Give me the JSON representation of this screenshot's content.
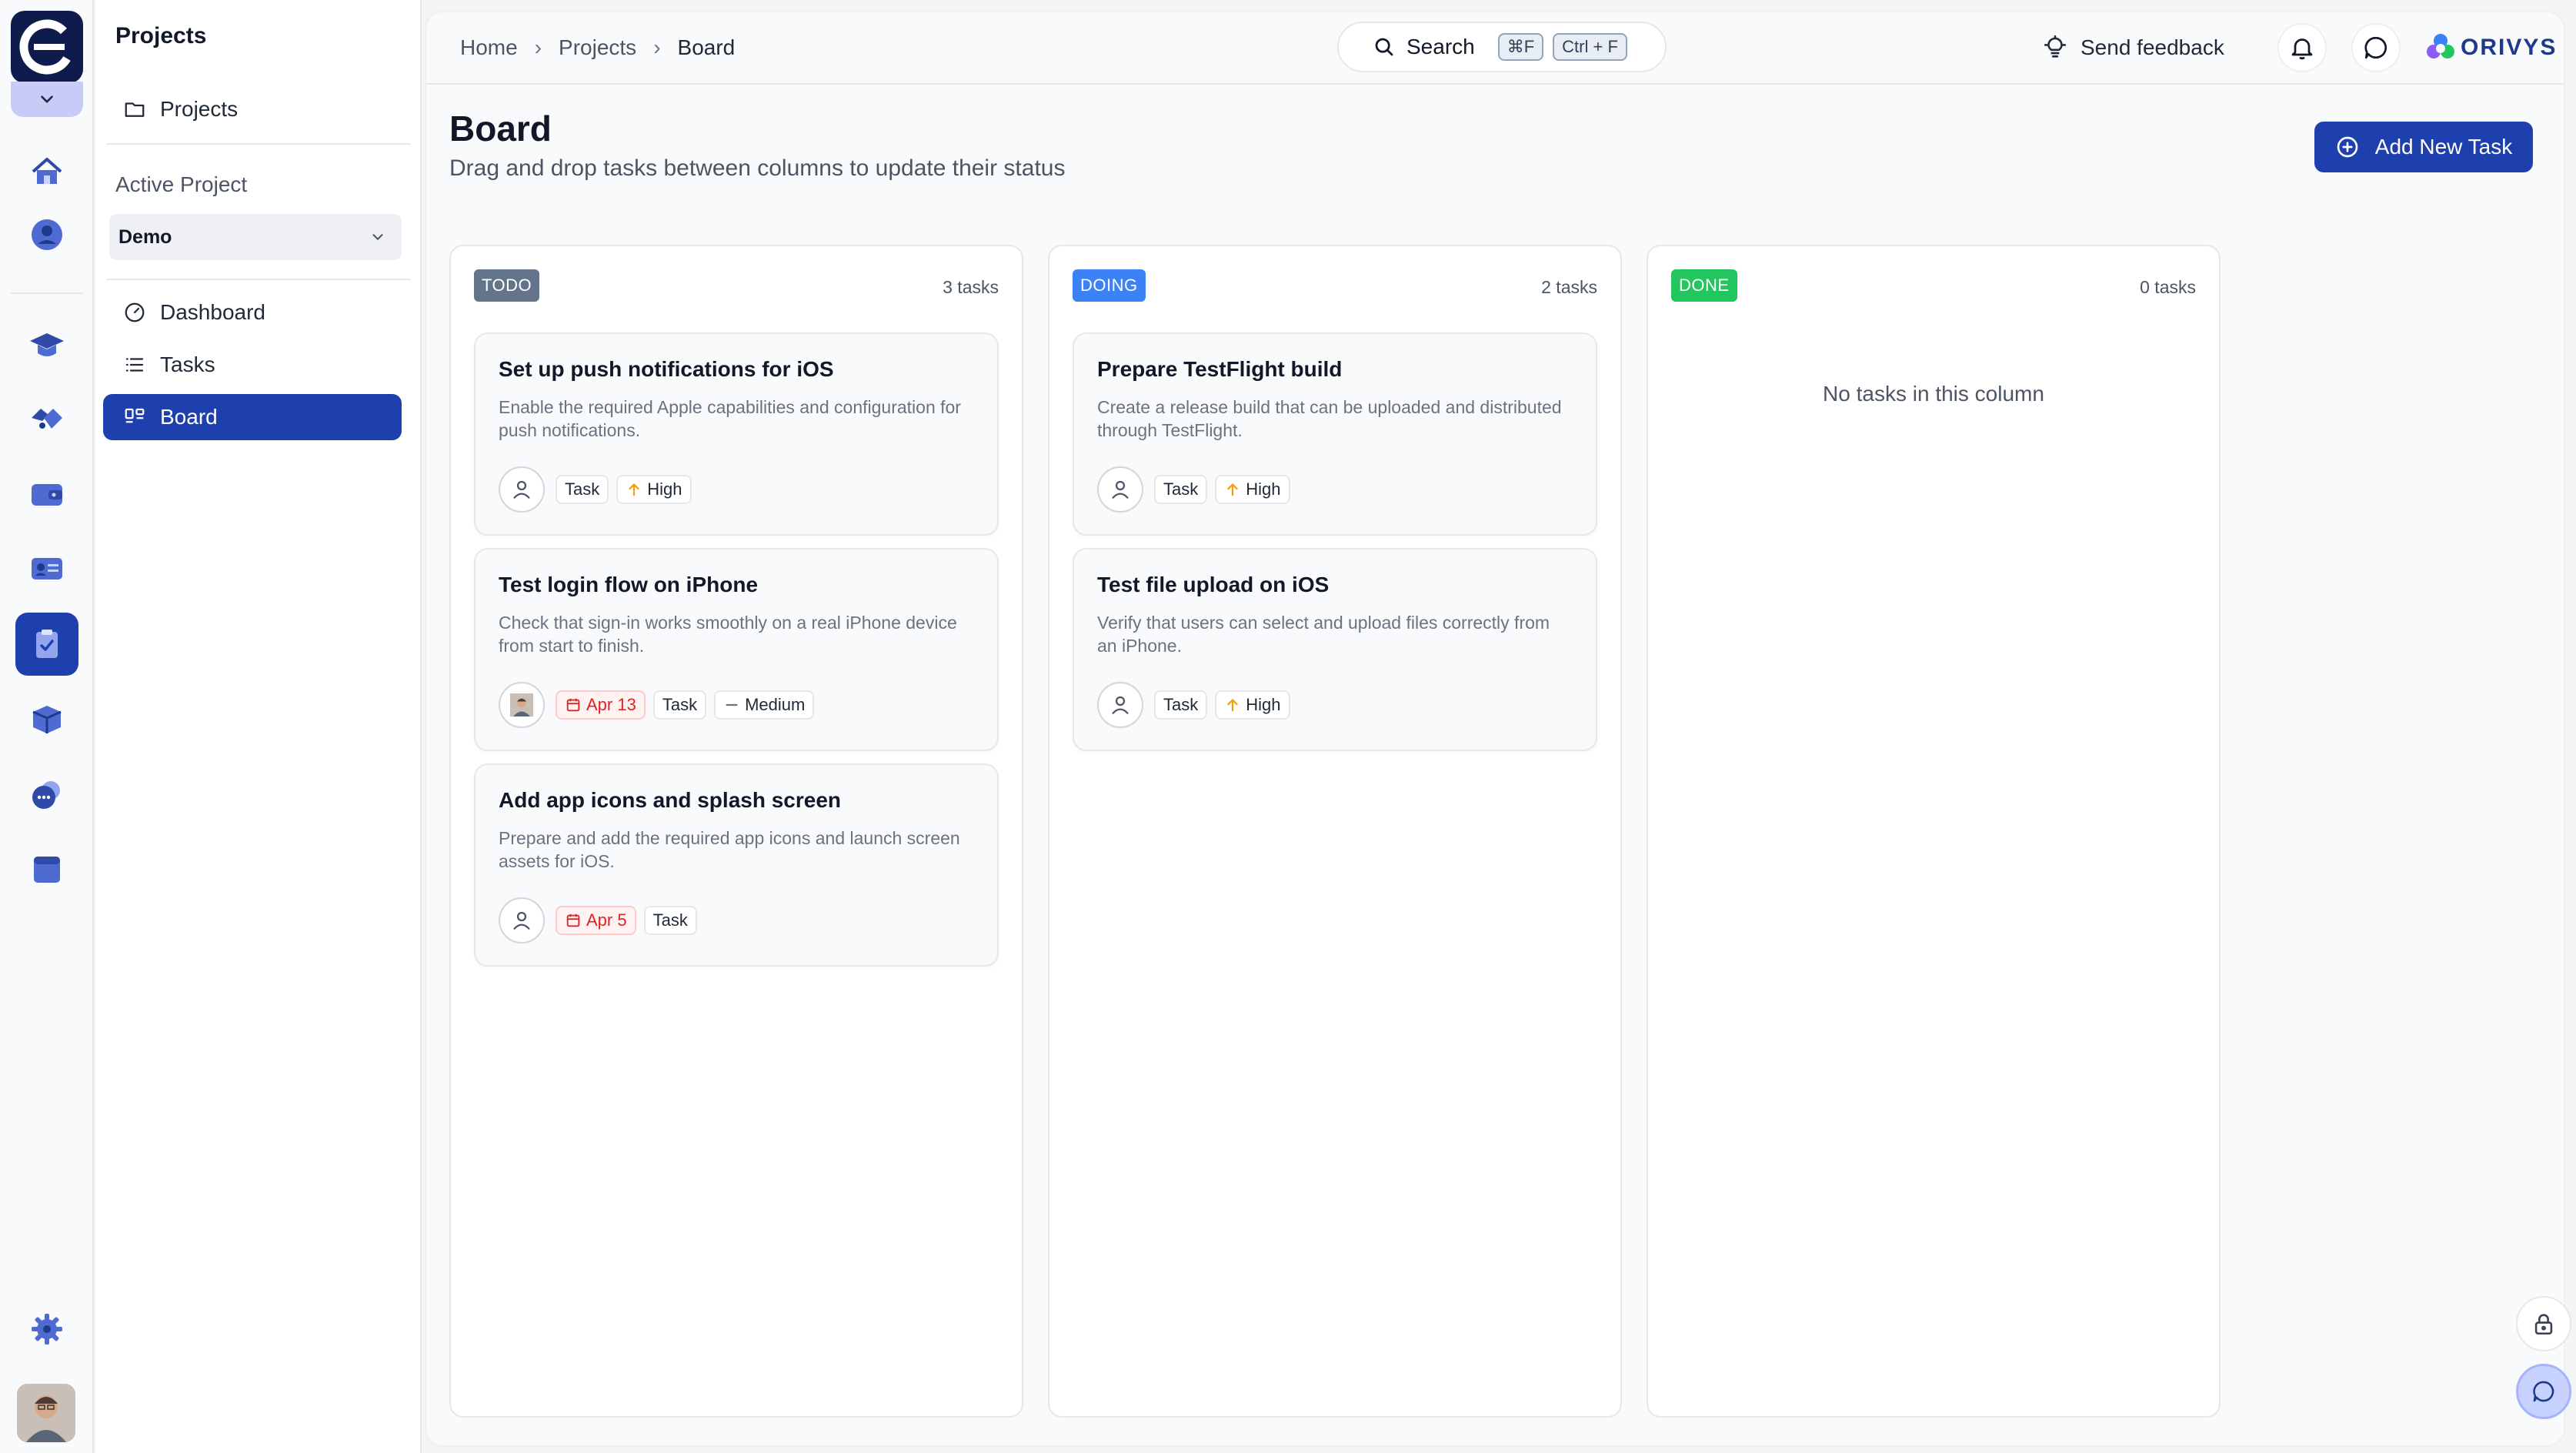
{
  "colors": {
    "primary": "#1e40af",
    "todo_badge": "#64748b",
    "doing_badge": "#3b82f6",
    "done_badge": "#22c55e",
    "overdue": "#dc2626",
    "priority_high": "#f59e0b"
  },
  "rail": {
    "items": [
      {
        "icon": "home-icon"
      },
      {
        "icon": "user-icon"
      },
      {
        "icon": "graduation-cap-icon"
      },
      {
        "icon": "handshake-icon"
      },
      {
        "icon": "wallet-icon"
      },
      {
        "icon": "id-card-icon"
      },
      {
        "icon": "clipboard-check-icon",
        "active": true
      },
      {
        "icon": "box-icon"
      },
      {
        "icon": "chat-bubbles-icon"
      },
      {
        "icon": "folder-icon"
      },
      {
        "icon": "gear-icon"
      }
    ]
  },
  "sidebar": {
    "title": "Projects",
    "projects_link": "Projects",
    "active_project_label": "Active Project",
    "active_project_value": "Demo",
    "nav": [
      {
        "label": "Dashboard",
        "icon": "gauge-icon"
      },
      {
        "label": "Tasks",
        "icon": "list-icon"
      },
      {
        "label": "Board",
        "icon": "board-icon",
        "active": true
      }
    ]
  },
  "header": {
    "breadcrumb": [
      "Home",
      "Projects",
      "Board"
    ],
    "search_label": "Search",
    "search_shortcut_mac": "⌘F",
    "search_shortcut_win": "Ctrl + F",
    "feedback_label": "Send feedback",
    "brand": "ORIVYS"
  },
  "page": {
    "title": "Board",
    "subtitle": "Drag and drop tasks between columns to update their status",
    "add_button": "Add New Task"
  },
  "columns": [
    {
      "badge": "TODO",
      "count": "3 tasks",
      "cards": [
        {
          "title": "Set up push notifications for iOS",
          "description": "Enable the required Apple capabilities and configuration for push notifications.",
          "type": "Task",
          "priority": "High"
        },
        {
          "title": "Test login flow on iPhone",
          "description": "Check that sign-in works smoothly on a real iPhone device from start to finish.",
          "due": "Apr 13",
          "type": "Task",
          "priority": "Medium"
        },
        {
          "title": "Add app icons and splash screen",
          "description": "Prepare and add the required app icons and launch screen assets for iOS.",
          "due": "Apr 5",
          "type": "Task"
        }
      ]
    },
    {
      "badge": "DOING",
      "count": "2 tasks",
      "cards": [
        {
          "title": "Prepare TestFlight build",
          "description": "Create a release build that can be uploaded and distributed through TestFlight.",
          "type": "Task",
          "priority": "High"
        },
        {
          "title": "Test file upload on iOS",
          "description": "Verify that users can select and upload files correctly from an iPhone.",
          "type": "Task",
          "priority": "High"
        }
      ]
    },
    {
      "badge": "DONE",
      "count": "0 tasks",
      "empty": "No tasks in this column",
      "cards": []
    }
  ]
}
